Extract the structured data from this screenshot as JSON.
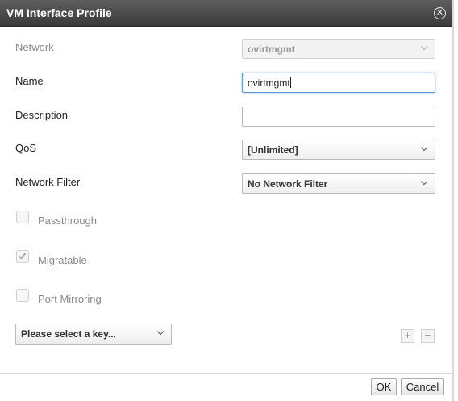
{
  "dialog": {
    "title": "VM Interface Profile",
    "close_glyph": "✕"
  },
  "form": {
    "network": {
      "label": "Network",
      "value": "ovirtmgmt",
      "disabled": true
    },
    "name": {
      "label": "Name",
      "value": "ovirtmgmt",
      "focused": true
    },
    "description": {
      "label": "Description",
      "value": ""
    },
    "qos": {
      "label": "QoS",
      "value": "[Unlimited]"
    },
    "network_filter": {
      "label": "Network Filter",
      "value": "No Network Filter"
    },
    "passthrough": {
      "label": "Passthrough",
      "checked": false,
      "disabled": true
    },
    "migratable": {
      "label": "Migratable",
      "checked": true,
      "disabled": true
    },
    "port_mirroring": {
      "label": "Port Mirroring",
      "checked": false,
      "disabled": true
    }
  },
  "custom_properties": {
    "key_select": "Please select a key...",
    "add_glyph": "+",
    "remove_glyph": "−"
  },
  "footer": {
    "ok_label": "OK",
    "cancel_label": "Cancel"
  },
  "icons": {
    "close": "close-icon",
    "chevron": "chevron-down-icon",
    "check": "check-icon"
  },
  "colors": {
    "header_bg": "#4a4a4a",
    "focus_border": "#5b9bd5",
    "disabled_text": "#8a8a8a"
  }
}
